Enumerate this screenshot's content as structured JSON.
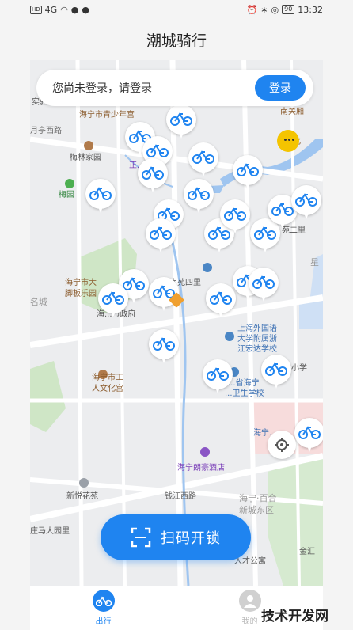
{
  "status_bar": {
    "left_text": "HD",
    "signal": "4G",
    "battery": "90",
    "time": "13:32"
  },
  "header": {
    "title": "潮城骑行"
  },
  "login_card": {
    "message": "您尚未登录，请登录",
    "button_label": "登录"
  },
  "map_labels": [
    "实验...",
    "海宁市青少年宫",
    "月亭西路",
    "梅林家园",
    "正...广场",
    "梅园",
    "南关厢",
    "文化",
    "苑二里",
    "海宁市大",
    "脚板乐园",
    "名城",
    "海...市政府",
    "南苑四里",
    "星",
    "上海外国语",
    "大学附属浙",
    "江宏达学校",
    "海宁市工",
    "人文化宫",
    "...省海宁",
    "...卫生学校",
    "小学",
    "海宁...",
    "海宁朗豪酒店",
    "钱江西路",
    "新悦花苑",
    "海宁·百合",
    "新城东区",
    "庄马大园里",
    "人才公寓",
    "金汇"
  ],
  "scan_button": {
    "label": "扫码开锁"
  },
  "tabbar": {
    "tabs": [
      {
        "label": "出行"
      },
      {
        "label": "我的"
      }
    ]
  },
  "watermark": "技术开发网",
  "colors": {
    "accent": "#1f84f0",
    "orange": "#f0a030",
    "marker_yellow": "#f4c400"
  }
}
